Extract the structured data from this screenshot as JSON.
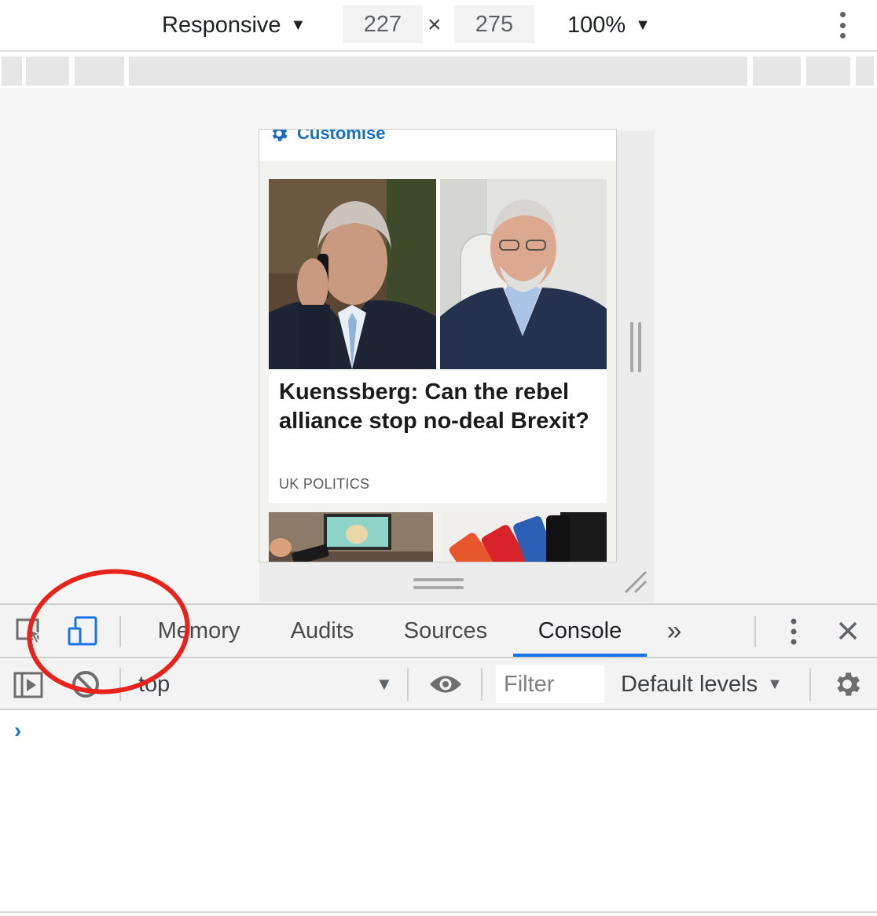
{
  "device_toolbar": {
    "device": "Responsive",
    "width": "227",
    "times": "×",
    "height": "275",
    "zoom": "100%",
    "menu_icon": "more-vertical-icon"
  },
  "page": {
    "customise_label": "Customise",
    "headline": "Kuenssberg: Can the rebel alliance stop no-deal Brexit?",
    "tag": "UK POLITICS"
  },
  "devtools": {
    "tabs": [
      {
        "label": "Memory"
      },
      {
        "label": "Audits"
      },
      {
        "label": "Sources"
      },
      {
        "label": "Console",
        "active": true
      }
    ],
    "more_tabs_label": "»"
  },
  "console": {
    "context": "top",
    "filter_placeholder": "Filter",
    "levels": "Default levels",
    "prompt": "›"
  },
  "colors": {
    "accent": "#1a73e8",
    "link": "#1a6ec2",
    "annotation": "#e8231b"
  }
}
